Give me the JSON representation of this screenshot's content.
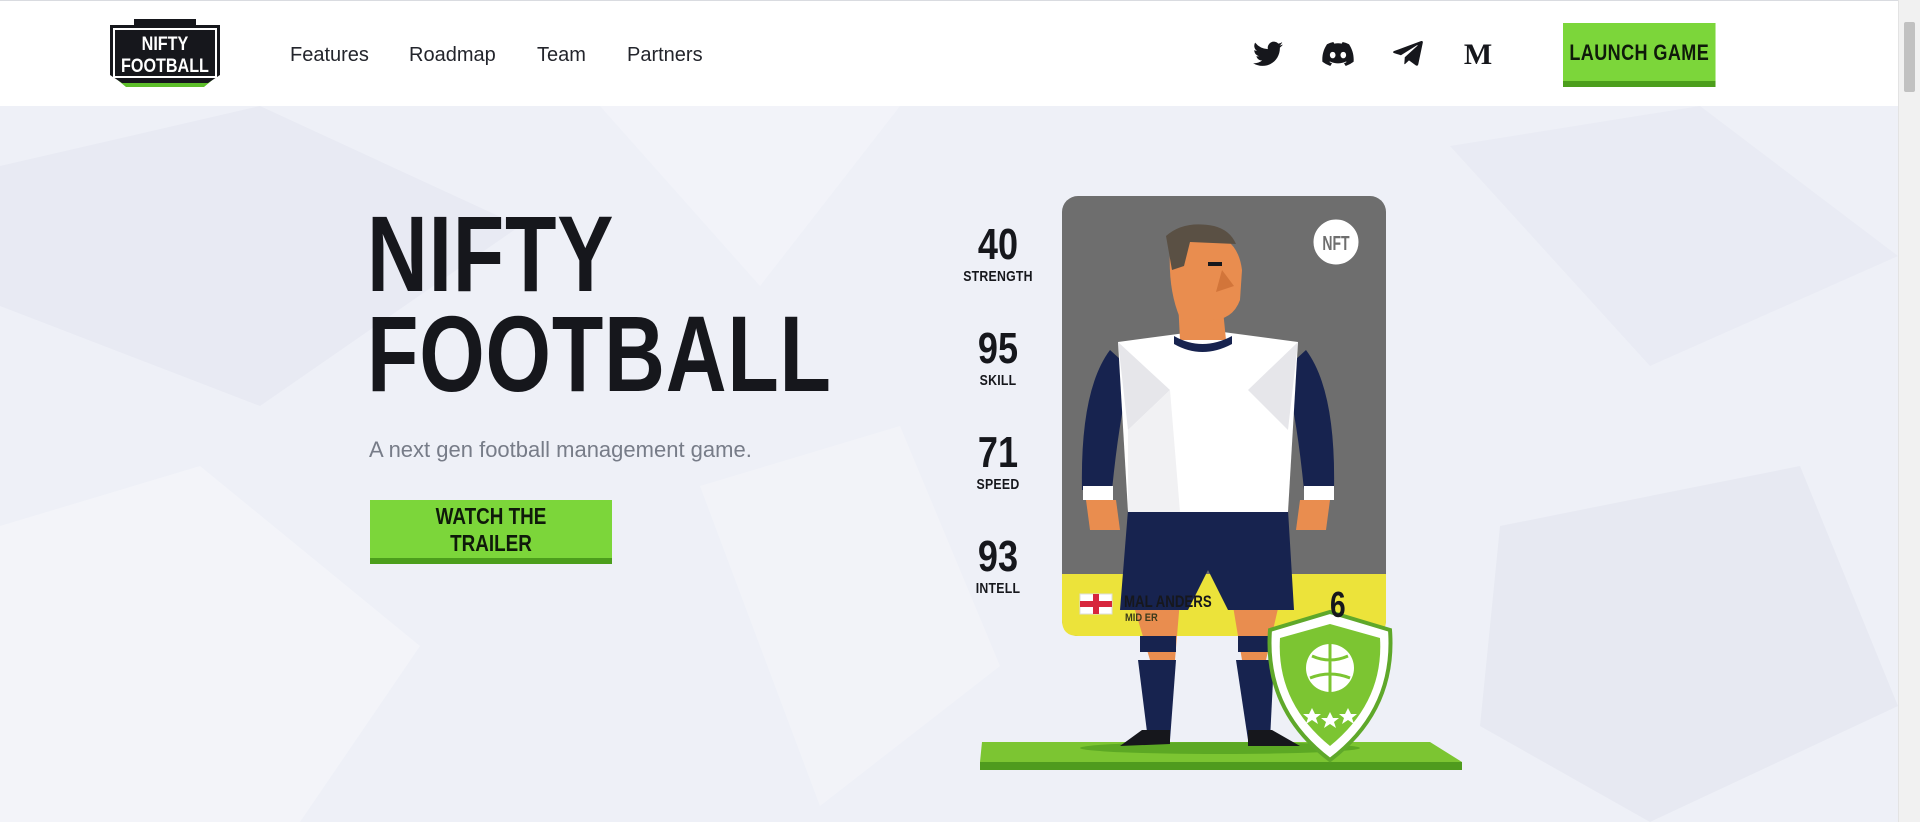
{
  "header": {
    "logo_text_line1": "NIFTY",
    "logo_text_line2": "FOOTBALL",
    "nav": [
      {
        "label": "Features"
      },
      {
        "label": "Roadmap"
      },
      {
        "label": "Team"
      },
      {
        "label": "Partners"
      }
    ],
    "social_icons": [
      "twitter-icon",
      "discord-icon",
      "telegram-icon",
      "medium-icon"
    ],
    "launch_label": "LAUNCH GAME"
  },
  "hero": {
    "title_line1": "NIFTY",
    "title_line2": "FOOTBALL",
    "subtitle": "A next gen football management game.",
    "trailer_label": "WATCH THE TRAILER"
  },
  "player_card": {
    "stats": [
      {
        "value": "40",
        "label": "STRENGTH"
      },
      {
        "value": "95",
        "label": "SKILL"
      },
      {
        "value": "71",
        "label": "SPEED"
      },
      {
        "value": "93",
        "label": "INTELL"
      }
    ],
    "name": "MAL    ANDERS",
    "position": "MID    ER",
    "rating": "6",
    "badge_monogram": "NFT"
  },
  "colors": {
    "accent_green": "#7cd63a",
    "accent_green_dark": "#4c9e1c",
    "card_grey": "#6e6e6e",
    "card_yellow": "#ece33a",
    "kit_navy": "#17234f"
  }
}
